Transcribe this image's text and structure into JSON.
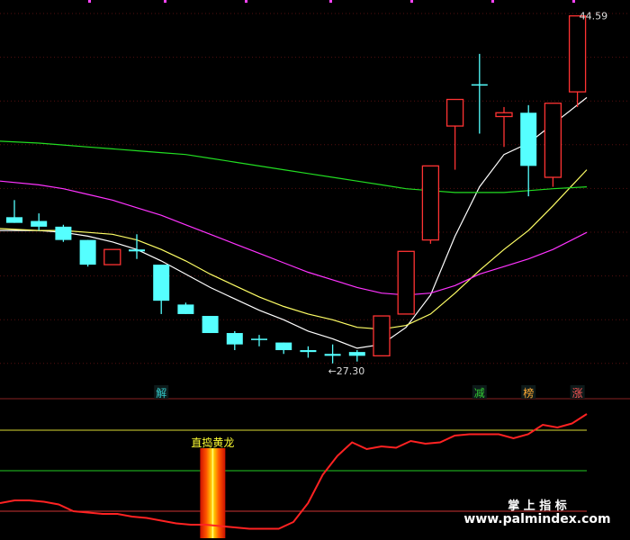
{
  "chart_data": {
    "type": "candlestick",
    "title": "",
    "price_ylim": [
      25.5,
      45.5
    ],
    "price_grid": true,
    "candles": [
      {
        "open": 34.3,
        "close": 34.0,
        "high": 35.2,
        "low": 34.0
      },
      {
        "open": 34.1,
        "close": 33.8,
        "high": 34.5,
        "low": 33.6
      },
      {
        "open": 33.8,
        "close": 33.1,
        "high": 33.9,
        "low": 33.0
      },
      {
        "open": 33.1,
        "close": 31.8,
        "high": 33.1,
        "low": 31.7
      },
      {
        "open": 31.8,
        "close": 32.6,
        "high": 32.6,
        "low": 31.8
      },
      {
        "open": 32.6,
        "close": 32.5,
        "high": 33.4,
        "low": 32.1
      },
      {
        "open": 31.8,
        "close": 29.9,
        "high": 31.8,
        "low": 29.2
      },
      {
        "open": 29.7,
        "close": 29.2,
        "high": 29.8,
        "low": 29.2
      },
      {
        "open": 29.1,
        "close": 28.2,
        "high": 29.1,
        "low": 28.2
      },
      {
        "open": 28.2,
        "close": 27.6,
        "high": 28.3,
        "low": 27.3
      },
      {
        "open": 27.9,
        "close": 27.9,
        "high": 28.1,
        "low": 27.5
      },
      {
        "open": 27.7,
        "close": 27.3,
        "high": 27.7,
        "low": 27.1
      },
      {
        "open": 27.3,
        "close": 27.2,
        "high": 27.5,
        "low": 26.9
      },
      {
        "open": 27.1,
        "close": 27.0,
        "high": 27.6,
        "low": 26.6
      },
      {
        "open": 27.2,
        "close": 27.0,
        "high": 27.3,
        "low": 26.7
      },
      {
        "open": 27.0,
        "close": 29.1,
        "high": 29.1,
        "low": 27.0
      },
      {
        "open": 29.2,
        "close": 32.5,
        "high": 32.5,
        "low": 29.2
      },
      {
        "open": 33.1,
        "close": 37.0,
        "high": 37.0,
        "low": 32.9
      },
      {
        "open": 39.1,
        "close": 40.5,
        "high": 40.5,
        "low": 36.8
      },
      {
        "open": 41.3,
        "close": 41.3,
        "high": 42.9,
        "low": 38.7
      },
      {
        "open": 39.6,
        "close": 39.8,
        "high": 40.1,
        "low": 38.0
      },
      {
        "open": 39.8,
        "close": 37.0,
        "high": 40.2,
        "low": 35.4
      },
      {
        "open": 36.4,
        "close": 40.3,
        "high": 40.3,
        "low": 35.9
      },
      {
        "open": 40.9,
        "close": 44.9,
        "high": 44.9,
        "low": 40.1
      }
    ],
    "ma_lines": [
      {
        "name": "MA5",
        "color": "#ffffff",
        "values": [
          33.6,
          33.6,
          33.5,
          33.3,
          33.0,
          32.6,
          32.0,
          31.3,
          30.6,
          30.0,
          29.4,
          28.9,
          28.3,
          27.9,
          27.4,
          27.6,
          28.5,
          30.2,
          33.3,
          35.9,
          37.6,
          38.2,
          39.2,
          40.6
        ]
      },
      {
        "name": "MA10",
        "color": "#ffff66",
        "values": [
          33.7,
          33.6,
          33.6,
          33.5,
          33.4,
          33.1,
          32.6,
          32.0,
          31.3,
          30.7,
          30.1,
          29.6,
          29.2,
          28.9,
          28.5,
          28.4,
          28.6,
          29.2,
          30.3,
          31.5,
          32.6,
          33.6,
          34.9,
          36.8
        ]
      },
      {
        "name": "MA20",
        "color": "#ff33ff",
        "values": [
          36.2,
          36.0,
          35.8,
          35.5,
          35.2,
          34.8,
          34.4,
          33.9,
          33.4,
          32.9,
          32.4,
          31.9,
          31.4,
          31.0,
          30.6,
          30.3,
          30.2,
          30.3,
          30.7,
          31.3,
          31.7,
          32.1,
          32.6,
          33.5
        ]
      },
      {
        "name": "MA60",
        "color": "#22dd22",
        "values": [
          38.3,
          38.2,
          38.1,
          38.0,
          37.9,
          37.8,
          37.7,
          37.6,
          37.4,
          37.2,
          37.0,
          36.8,
          36.6,
          36.4,
          36.2,
          36.0,
          35.8,
          35.7,
          35.6,
          35.6,
          35.6,
          35.7,
          35.8,
          35.9
        ]
      }
    ],
    "high_annotation": "44.59",
    "low_annotation": "←27.30",
    "signals": [
      {
        "label": "解",
        "candle_index": 6,
        "color": "#33cccc"
      },
      {
        "label": "减",
        "candle_index": 19,
        "color": "#33cc33"
      },
      {
        "label": "榜",
        "candle_index": 21,
        "color": "#ffaa33"
      },
      {
        "label": "涨",
        "candle_index": 23,
        "color": "#ff5555"
      }
    ],
    "indicator": {
      "ylim": [
        0,
        100
      ],
      "levels": [
        {
          "value": 80,
          "color": "#dddd33"
        },
        {
          "value": 50,
          "color": "#22cc22"
        },
        {
          "value": 20,
          "color": "#cc3333"
        }
      ],
      "line_color": "#ff2222",
      "line_values": [
        26,
        28,
        28,
        27,
        25,
        20,
        19,
        18,
        18,
        16,
        15,
        13,
        11,
        10,
        10,
        9,
        8,
        7,
        7,
        7,
        12,
        26,
        47,
        61,
        71,
        66,
        68,
        67,
        72,
        70,
        71,
        76,
        77,
        77,
        77,
        74,
        77,
        84,
        82,
        85,
        92
      ],
      "highlight_label": "直捣黄龙",
      "highlight_x_index": 14.5
    },
    "watermark": {
      "line1": "掌 上 指 标",
      "line2": "www.palmindex.com"
    }
  }
}
